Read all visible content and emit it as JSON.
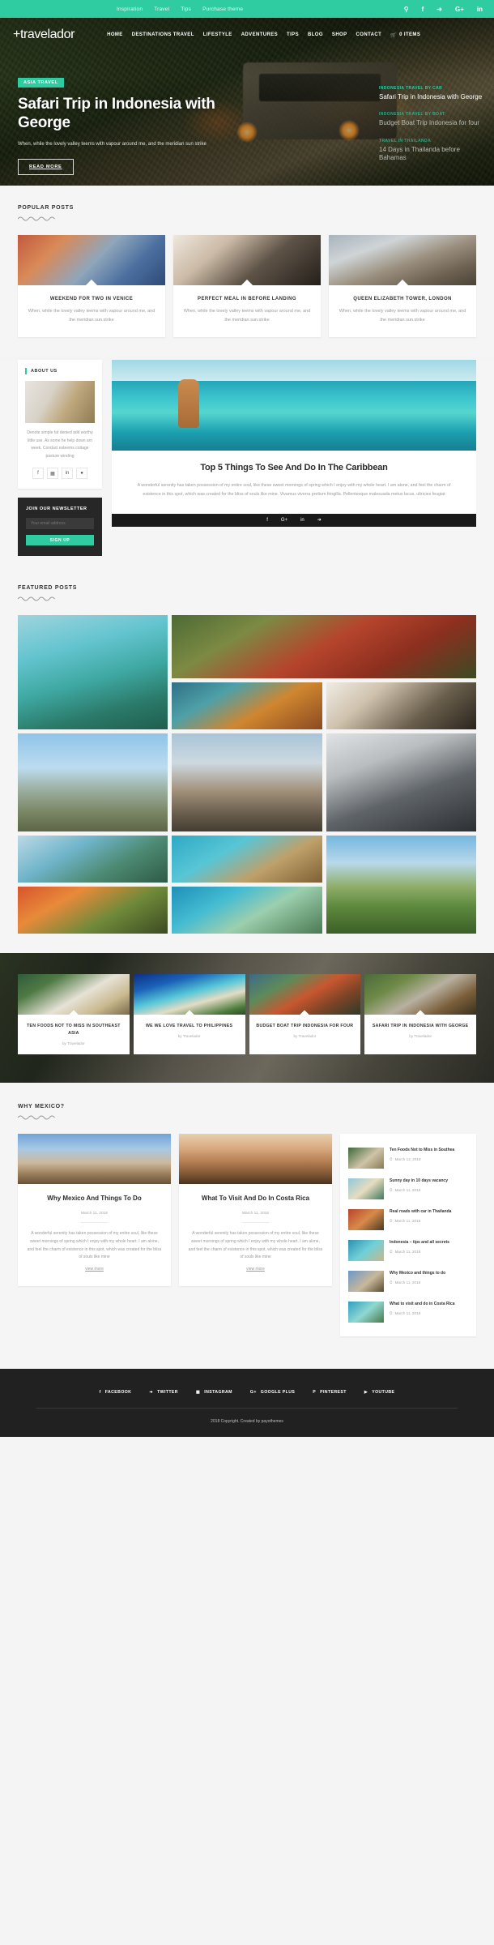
{
  "topbar": {
    "links": [
      "Inspiration",
      "Travel",
      "Tips",
      "Purchase theme"
    ],
    "social": [
      "search-icon",
      "f",
      "t",
      "G+",
      "in"
    ]
  },
  "header": {
    "logo": "travelador",
    "menu": [
      {
        "label": "HOME"
      },
      {
        "label": "DESTINATIONS TRAVEL"
      },
      {
        "label": "LIFESTYLE"
      },
      {
        "label": "ADVENTURES"
      },
      {
        "label": "TIPS"
      },
      {
        "label": "BLOG"
      },
      {
        "label": "SHOP"
      },
      {
        "label": "CONTACT"
      }
    ],
    "cart": "0 ITEMS"
  },
  "hero": {
    "badge": "ASIA TRAVEL",
    "title": "Safari Trip in Indonesia with George",
    "description": "When, while the lovely valley teems with vapour around me, and the meridian sun strike",
    "button": "READ MORE",
    "side_posts": [
      {
        "category": "INDONESIA TRAVEL BY CAR",
        "title": "Safari Trip in Indonesia with George"
      },
      {
        "category": "INDONESIA TRAVEL BY BOAT",
        "title": "Budget Boat Trip Indonesia for four"
      },
      {
        "category": "TRAVEL IN THAILANDA",
        "title": "14 Days in Thailanda before Bahamas"
      }
    ]
  },
  "popular": {
    "heading": "POPULAR POSTS",
    "cards": [
      {
        "title": "WEEKEND FOR TWO IN VENICE",
        "text": "When, while the lovely valley teems with vapour around me, and the meridian sun strike"
      },
      {
        "title": "PERFECT MEAL IN BEFORE LANDING",
        "text": "When, while the lovely valley teems with vapour around me, and the meridian sun strike"
      },
      {
        "title": "QUEEN ELIZABETH TOWER, LONDON",
        "text": "When, while the lovely valley teems with vapour around me, and the meridian sun strike"
      }
    ]
  },
  "about": {
    "heading": "ABOUT US",
    "text": "Denote simple fat denied add worthy little use. As some he help down am week. Conduct esteems cottage pasture winding",
    "social": [
      "f",
      "▣",
      "in",
      "●"
    ]
  },
  "newsletter": {
    "heading": "JOIN OUR NEWSLETTER",
    "placeholder": "Your email address",
    "button": "SIGN UP"
  },
  "feature": {
    "title": "Top 5 Things To See And Do In The Caribbean",
    "text": "A wonderful serenity has taken possession of my entire soul, like these sweet mornings of spring which I enjoy with my whole heart. I am alone, and feel the charm of existence in this spot, which was created for the bliss of souls like mine. Vivamus viverra pretium fringilla. Pellentesque malesuada metus lacus, ultricies feugiat",
    "share": [
      "f",
      "G+",
      "in",
      "t"
    ]
  },
  "featured": {
    "heading": "FEATURED POSTS"
  },
  "strip": {
    "cards": [
      {
        "title": "TEN FOODS NOT TO MISS IN SOUTHEAST ASIA",
        "by": "by Travelador"
      },
      {
        "title": "WE WE LOVE TRAVEL TO PHILIPPINES",
        "by": "by Travelador"
      },
      {
        "title": "BUDGET BOAT TRIP INDONESIA FOR FOUR",
        "by": "by Travelador"
      },
      {
        "title": "SAFARI TRIP IN INDONESIA WITH GEORGE",
        "by": "by Travelador"
      }
    ]
  },
  "mexico": {
    "heading": "WHY MEXICO?",
    "cards": [
      {
        "title": "Why Mexico And Things To Do",
        "date": "March 11, 2018",
        "text": "A wonderful serenity has taken possession of my entire soul, like these sweet mornings of spring which I enjoy with my whole heart. I am alone, and feel the charm of existence in this spot, which was created for the bliss of souls like mine",
        "more": "view more"
      },
      {
        "title": "What To Visit And Do In Costa Rica",
        "date": "March 11, 2018",
        "text": "A wonderful serenity has taken possession of my entire soul, like these sweet mornings of spring which I enjoy with my whole heart. I am alone, and feel the charm of existence in this spot, which was created for the bliss of souls like mine",
        "more": "view more"
      }
    ],
    "list": [
      {
        "title": "Ten Foods Not to Miss in Southea",
        "date": "March 12, 2018"
      },
      {
        "title": "Sunny day in 10 days vacancy",
        "date": "March 11, 2018"
      },
      {
        "title": "Real roads with car in Thailanda",
        "date": "March 11, 2018"
      },
      {
        "title": "Indonesia – tips and all secrets",
        "date": "March 11, 2018"
      },
      {
        "title": "Why Mexico and things to do",
        "date": "March 11, 2018"
      },
      {
        "title": "What to visit and do in Costa Rica",
        "date": "March 11, 2018"
      }
    ]
  },
  "footer": {
    "social": [
      {
        "icon": "f",
        "label": "FACEBOOK"
      },
      {
        "icon": "✉",
        "label": "TWITTER"
      },
      {
        "icon": "▣",
        "label": "INSTAGRAM"
      },
      {
        "icon": "G+",
        "label": "GOOGLE PLUS"
      },
      {
        "icon": "P",
        "label": "PINTEREST"
      },
      {
        "icon": "▶",
        "label": "YOUTUBE"
      }
    ],
    "copyright": "2018 Copyright. Created by payothemes"
  },
  "colors": {
    "accent": "#2ecca0",
    "dark": "#212121",
    "body_bg": "#f5f5f5"
  }
}
